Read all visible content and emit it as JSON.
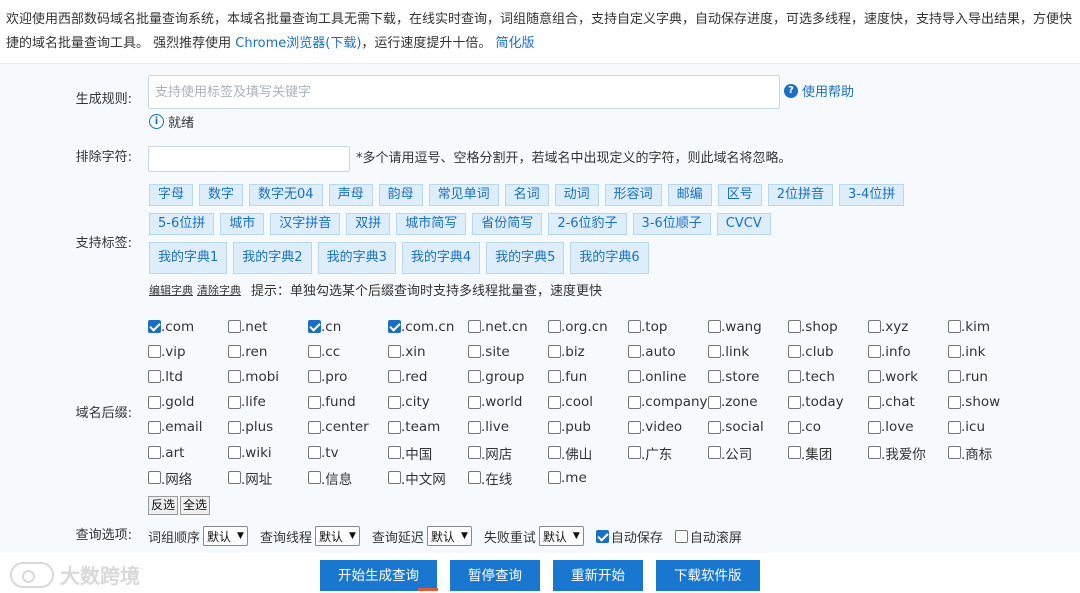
{
  "intro": {
    "text1": "欢迎使用西部数码域名批量查询系统，本域名批量查询工具无需下载，在线实时查询，词组随意组合，支持自定义字典，自动保存进度，可选多线程，速度快，支持导入导出结果，方便快捷的域名批量查询工具。 强烈推荐使用 ",
    "chrome_link": "Chrome浏览器(下载)",
    "text2": "，运行速度提升十倍。 ",
    "simple_link": "简化版"
  },
  "form": {
    "rule_label": "生成规则:",
    "rule_placeholder": "支持使用标签及填写关键字",
    "help_label": "使用帮助",
    "status_text": "就绪",
    "exclude_label": "排除字符:",
    "exclude_hint": "*多个请用逗号、空格分割开，若域名中出现定义的字符，则此域名将忽略。",
    "tags_label": "支持标签:",
    "tags_row1": [
      "字母",
      "数字",
      "数字无04",
      "声母",
      "韵母",
      "常见单词",
      "名词",
      "动词",
      "形容词",
      "邮编",
      "区号",
      "2位拼音",
      "3-4位拼"
    ],
    "tags_row2": [
      "5-6位拼",
      "城市",
      "汉字拼音",
      "双拼",
      "城市简写",
      "省份简写",
      "2-6位豹子",
      "3-6位顺子",
      "CVCV"
    ],
    "tags_row3": [
      "我的字典1",
      "我的字典2",
      "我的字典3",
      "我的字典4",
      "我的字典5",
      "我的字典6"
    ],
    "edit_dict": "编辑字典",
    "clear_dict": "清除字典",
    "dict_hint": "提示：单独勾选某个后缀查询时支持多线程批量查，速度更快",
    "suffix_label": "域名后缀:",
    "suffixes": [
      {
        "name": ".com",
        "checked": true
      },
      {
        "name": ".net",
        "checked": false
      },
      {
        "name": ".cn",
        "checked": true
      },
      {
        "name": ".com.cn",
        "checked": true
      },
      {
        "name": ".net.cn",
        "checked": false
      },
      {
        "name": ".org.cn",
        "checked": false
      },
      {
        "name": ".top",
        "checked": false
      },
      {
        "name": ".wang",
        "checked": false
      },
      {
        "name": ".shop",
        "checked": false
      },
      {
        "name": ".xyz",
        "checked": false
      },
      {
        "name": ".kim",
        "checked": false
      },
      {
        "name": "",
        "checked": false
      },
      {
        "name": ".vip",
        "checked": false
      },
      {
        "name": ".ren",
        "checked": false
      },
      {
        "name": ".cc",
        "checked": false
      },
      {
        "name": ".xin",
        "checked": false
      },
      {
        "name": ".site",
        "checked": false
      },
      {
        "name": ".biz",
        "checked": false
      },
      {
        "name": ".auto",
        "checked": false
      },
      {
        "name": ".link",
        "checked": false
      },
      {
        "name": ".club",
        "checked": false
      },
      {
        "name": ".info",
        "checked": false
      },
      {
        "name": ".ink",
        "checked": false
      },
      {
        "name": "",
        "checked": false
      },
      {
        "name": ".ltd",
        "checked": false
      },
      {
        "name": ".mobi",
        "checked": false
      },
      {
        "name": ".pro",
        "checked": false
      },
      {
        "name": ".red",
        "checked": false
      },
      {
        "name": ".group",
        "checked": false
      },
      {
        "name": ".fun",
        "checked": false
      },
      {
        "name": ".online",
        "checked": false
      },
      {
        "name": ".store",
        "checked": false
      },
      {
        "name": ".tech",
        "checked": false
      },
      {
        "name": ".work",
        "checked": false
      },
      {
        "name": ".run",
        "checked": false
      },
      {
        "name": "",
        "checked": false
      },
      {
        "name": ".gold",
        "checked": false
      },
      {
        "name": ".life",
        "checked": false
      },
      {
        "name": ".fund",
        "checked": false
      },
      {
        "name": ".city",
        "checked": false
      },
      {
        "name": ".world",
        "checked": false
      },
      {
        "name": ".cool",
        "checked": false
      },
      {
        "name": ".company",
        "checked": false
      },
      {
        "name": ".zone",
        "checked": false
      },
      {
        "name": ".today",
        "checked": false
      },
      {
        "name": ".chat",
        "checked": false
      },
      {
        "name": ".show",
        "checked": false
      },
      {
        "name": "",
        "checked": false
      },
      {
        "name": ".email",
        "checked": false
      },
      {
        "name": ".plus",
        "checked": false
      },
      {
        "name": ".center",
        "checked": false
      },
      {
        "name": ".team",
        "checked": false
      },
      {
        "name": ".live",
        "checked": false
      },
      {
        "name": ".pub",
        "checked": false
      },
      {
        "name": ".video",
        "checked": false
      },
      {
        "name": ".social",
        "checked": false
      },
      {
        "name": ".co",
        "checked": false
      },
      {
        "name": ".love",
        "checked": false
      },
      {
        "name": ".icu",
        "checked": false
      },
      {
        "name": "",
        "checked": false
      },
      {
        "name": ".art",
        "checked": false
      },
      {
        "name": ".wiki",
        "checked": false
      },
      {
        "name": ".tv",
        "checked": false
      },
      {
        "name": ".中国",
        "checked": false
      },
      {
        "name": ".网店",
        "checked": false
      },
      {
        "name": ".佛山",
        "checked": false
      },
      {
        "name": ".广东",
        "checked": false
      },
      {
        "name": ".公司",
        "checked": false
      },
      {
        "name": ".集团",
        "checked": false
      },
      {
        "name": ".我爱你",
        "checked": false
      },
      {
        "name": ".商标",
        "checked": false
      },
      {
        "name": "",
        "checked": false
      },
      {
        "name": ".网络",
        "checked": false
      },
      {
        "name": ".网址",
        "checked": false
      },
      {
        "name": ".信息",
        "checked": false
      },
      {
        "name": ".中文网",
        "checked": false
      },
      {
        "name": ".在线",
        "checked": false
      },
      {
        "name": ".me",
        "checked": false
      }
    ],
    "invert_label": "反选",
    "select_all_label": "全选",
    "options_label": "查询选项:",
    "opt_order_label": "词组顺序",
    "opt_thread_label": "查询线程",
    "opt_delay_label": "查询延迟",
    "opt_retry_label": "失败重试",
    "default_value": "默认",
    "auto_save_label": "自动保存",
    "auto_save_checked": true,
    "auto_scroll_label": "自动滚屏",
    "auto_scroll_checked": false
  },
  "actions": {
    "start": "开始生成查询",
    "pause": "暂停查询",
    "restart": "重新开始",
    "download": "下载软件版"
  },
  "watermark": "大数跨境",
  "colors": {
    "accent": "#1a77d0",
    "link": "#1a6fc4",
    "tag_bg": "#ddeefa"
  }
}
